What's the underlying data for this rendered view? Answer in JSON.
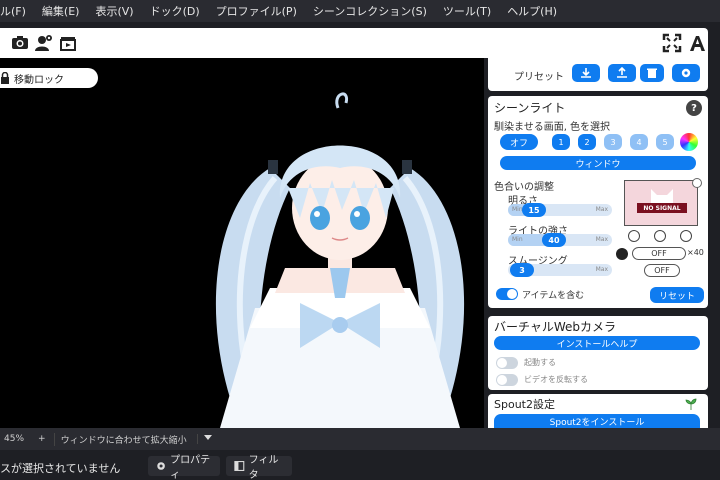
{
  "menu": [
    "ル(F)",
    "編集(E)",
    "表示(V)",
    "ドック(D)",
    "プロファイル(P)",
    "シーンコレクション(S)",
    "ツール(T)",
    "ヘルプ(H)"
  ],
  "toolbar": {
    "icons": [
      "camera-icon",
      "user-settings-icon",
      "clapperboard-icon",
      "fullscreen-icon",
      "font-a-icon"
    ]
  },
  "viewport": {
    "lock_label": "移動ロック"
  },
  "preset": {
    "label": "プリセット"
  },
  "scene_light": {
    "title": "シーンライト",
    "help": "?",
    "select_label": "馴染ませる画面, 色を選択",
    "off_label": "オフ",
    "numbers": [
      "1",
      "2",
      "3",
      "4",
      "5"
    ],
    "window_label": "ウィンドウ",
    "adjust_label": "色合いの調整",
    "brightness_label": "明るさ",
    "brightness_value": "15",
    "intensity_label": "ライトの強さ",
    "intensity_value": "40",
    "smoothing_label": "スムージング",
    "smoothing_value": "3",
    "min": "Min",
    "max": "Max",
    "preview_text": "NO SIGNAL",
    "off_a": "OFF",
    "off_b": "OFF",
    "multiplier": "×40",
    "include_items_label": "アイテムを含む",
    "reset_label": "リセット",
    "colors": {
      "accent": "#0f7cf0",
      "disabled": "#8fc0f5",
      "preview_bg": "#f4d6dc"
    }
  },
  "webcam": {
    "title": "バーチャルWebカメラ",
    "install_help_label": "インストールヘルプ",
    "start_label": "起動する",
    "flip_label": "ビデオを反転する"
  },
  "spout": {
    "title": "Spout2設定",
    "install_label": "Spout2をインストール"
  },
  "status": {
    "zoom": "45%",
    "plus": "+",
    "fit_label": "ウィンドウに合わせて拡大縮小"
  },
  "bottom": {
    "no_selection": "スが選択されていません",
    "properties_label": "プロパティ",
    "filters_label": "フィルタ"
  }
}
